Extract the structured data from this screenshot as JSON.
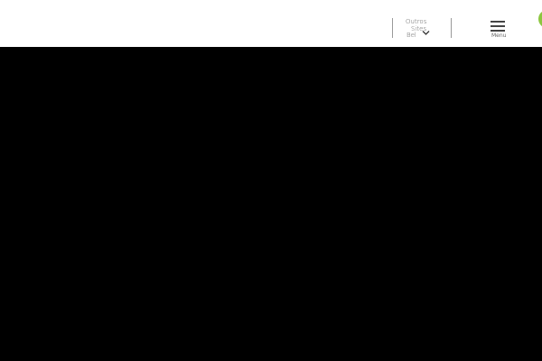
{
  "header": {
    "sites_dropdown": {
      "line1": "Outros",
      "line2": "Sites",
      "line3": "Bel"
    },
    "menu": {
      "label": "Menu"
    }
  },
  "colors": {
    "header_bg": "#ffffff",
    "main_bg": "#000000",
    "logo_green": "#8cc63f",
    "logo_orange": "#e05a2b"
  },
  "icons": {
    "dropdown": "chevron-down-icon",
    "menu": "hamburger-icon"
  }
}
